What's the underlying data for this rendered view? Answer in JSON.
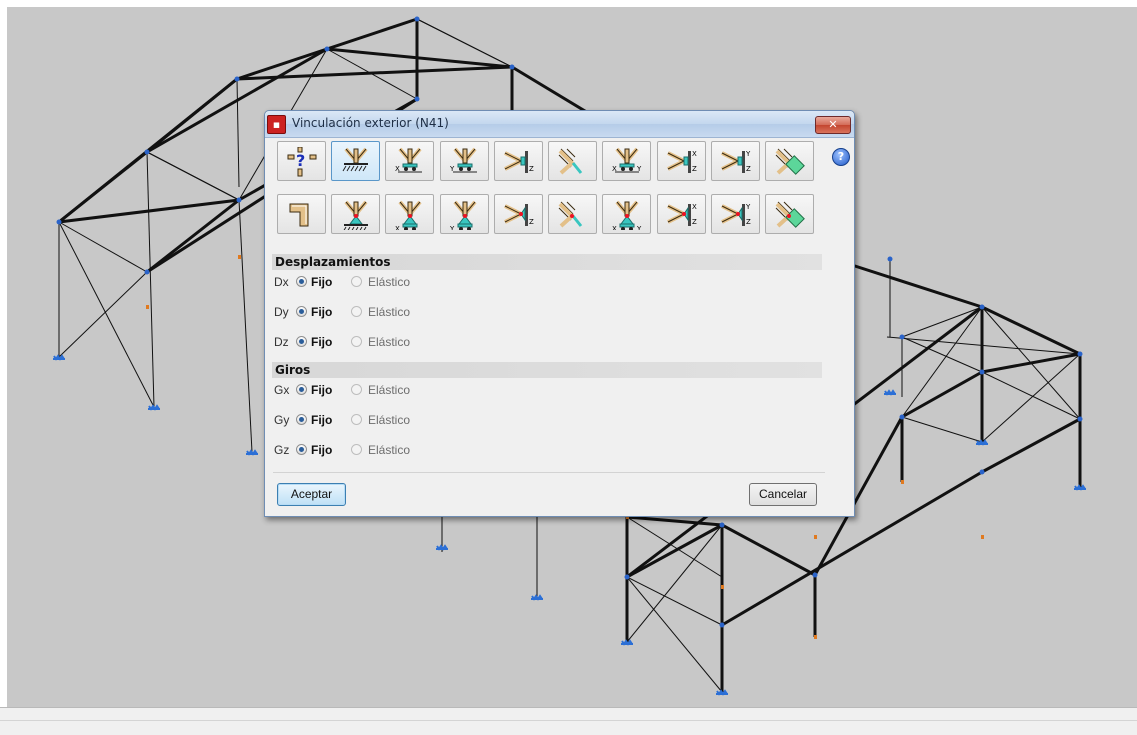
{
  "dialog": {
    "title": "Vinculación exterior (N41)",
    "close_symbol": "✕",
    "help_symbol": "?",
    "app_icon": "app-icon",
    "toolbar": {
      "selected_index": 1,
      "row1_icons": [
        "undefined-support-icon",
        "fixed-support-icon",
        "sliding-x-support-icon",
        "sliding-y-support-icon",
        "wall-fixed-z-icon",
        "inclined-support-icon",
        "sliding-xy-support-icon",
        "wall-x-z-icon",
        "wall-y-z-icon",
        "inclined-plane-support-icon"
      ],
      "row2_icons": [
        "corner-support-icon",
        "pinned-support-icon",
        "pinned-sliding-x-icon",
        "pinned-sliding-y-icon",
        "wall-pinned-z-icon",
        "inclined-pinned-icon",
        "pinned-sliding-xy-icon",
        "wall-pinned-x-z-icon",
        "wall-pinned-y-z-icon",
        "inclined-plane-pinned-icon"
      ],
      "undefined_glyph": "?",
      "axis_labels": {
        "x": "X",
        "y": "Y",
        "z": "Z"
      }
    },
    "sections": {
      "displacements": {
        "title": "Desplazamientos",
        "rows": [
          {
            "label": "Dx",
            "fixed": "Fijo",
            "elastic": "Elástico",
            "selected": "Fijo"
          },
          {
            "label": "Dy",
            "fixed": "Fijo",
            "elastic": "Elástico",
            "selected": "Fijo"
          },
          {
            "label": "Dz",
            "fixed": "Fijo",
            "elastic": "Elástico",
            "selected": "Fijo"
          }
        ]
      },
      "rotations": {
        "title": "Giros",
        "rows": [
          {
            "label": "Gx",
            "fixed": "Fijo",
            "elastic": "Elástico",
            "selected": "Fijo"
          },
          {
            "label": "Gy",
            "fixed": "Fijo",
            "elastic": "Elástico",
            "selected": "Fijo"
          },
          {
            "label": "Gz",
            "fixed": "Fijo",
            "elastic": "Elástico",
            "selected": "Fijo"
          }
        ]
      }
    },
    "buttons": {
      "ok": "Aceptar",
      "cancel": "Cancelar"
    }
  },
  "colors": {
    "viewport_bg": "#c8c8c8",
    "member": "#111111",
    "node": "#2a63c9",
    "support": "#2b6fd6",
    "free_end": "#e07a20"
  }
}
